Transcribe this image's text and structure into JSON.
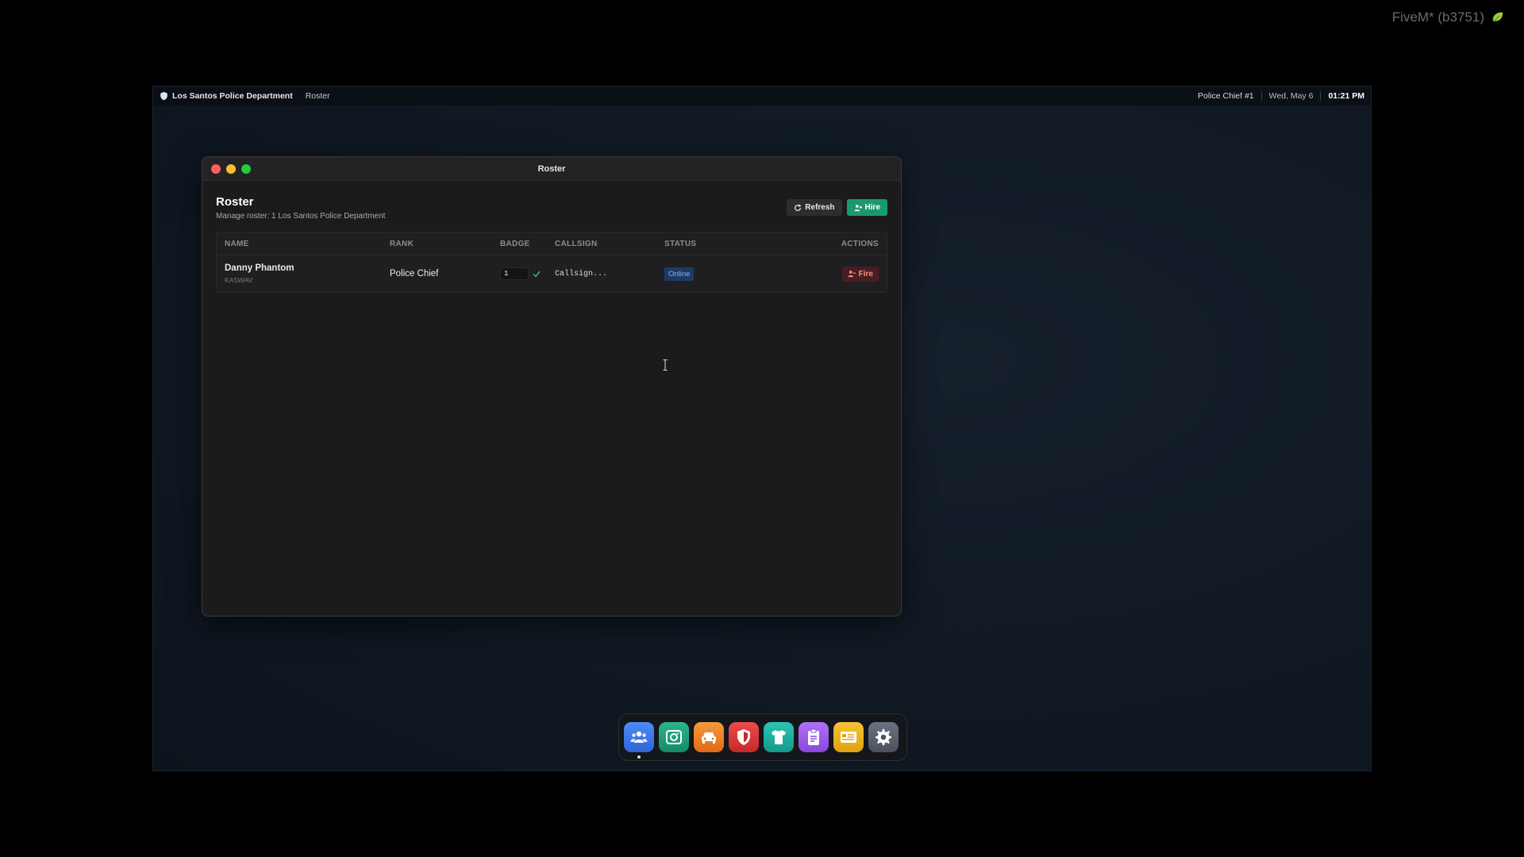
{
  "overlay": {
    "fivem_label": "FiveM* (b3751)"
  },
  "menubar": {
    "department": "Los Santos Police Department",
    "menu": "Roster",
    "user": "Police Chief #1",
    "date": "Wed, May 6",
    "time": "01:21 PM"
  },
  "window": {
    "title": "Roster",
    "heading": "Roster",
    "subtitle": "Manage roster: 1 Los Santos Police Department",
    "refresh_label": "Refresh",
    "hire_label": "Hire"
  },
  "table": {
    "columns": [
      "NAME",
      "RANK",
      "BADGE",
      "CALLSIGN",
      "STATUS",
      "ACTIONS"
    ],
    "rows": [
      {
        "name": "Danny Phantom",
        "id": "KASWAV",
        "rank": "Police Chief",
        "badge": "1",
        "callsign_placeholder": "Callsign...",
        "status": "Online",
        "action": "Fire"
      }
    ]
  },
  "dock": {
    "items": [
      {
        "icon": "users-icon",
        "active": true
      },
      {
        "icon": "camera-icon"
      },
      {
        "icon": "car-icon"
      },
      {
        "icon": "shield-icon"
      },
      {
        "icon": "shirt-icon"
      },
      {
        "icon": "clipboard-icon"
      },
      {
        "icon": "id-card-icon"
      },
      {
        "icon": "gear-icon"
      }
    ]
  },
  "colors": {
    "accent_green": "#1a9a6c",
    "fire_red": "#4a1d22",
    "status_blue": "#1d3a63"
  }
}
